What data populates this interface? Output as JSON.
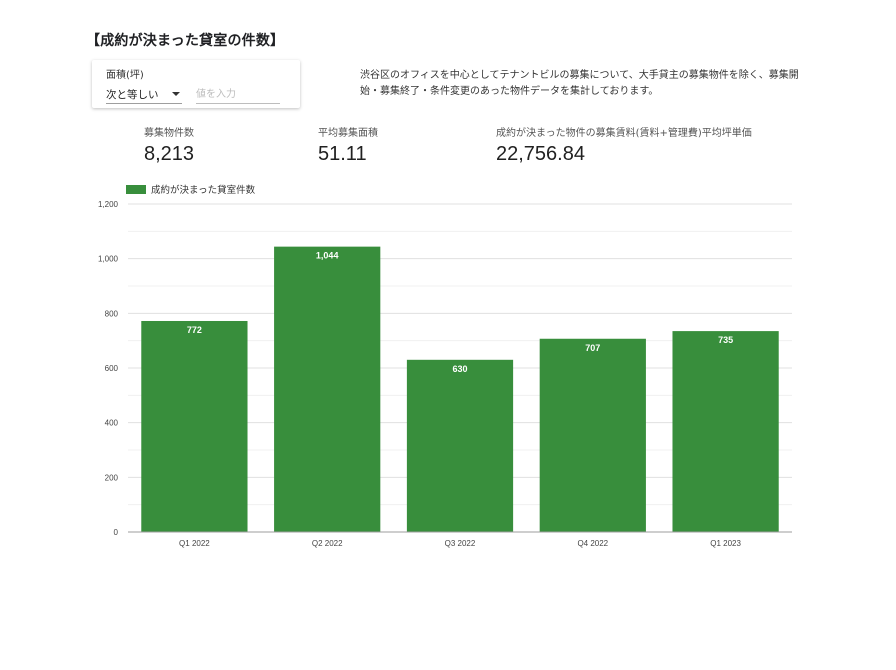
{
  "title": "【成約が決まった貸室の件数】",
  "filter": {
    "label": "面積(坪)",
    "operator": "次と等しい",
    "placeholder": "値を入力"
  },
  "description": "渋谷区のオフィスを中心としてテナントビルの募集について、大手貸主の募集物件を除く、募集開始・募集終了・条件変更のあった物件データを集計しております。",
  "kpis": [
    {
      "label": "募集物件数",
      "value": "8,213"
    },
    {
      "label": "平均募集面積",
      "value": "51.11"
    },
    {
      "label": "成約が決まった物件の募集賃料(賃料+管理費)平均坪単価",
      "value": "22,756.84"
    }
  ],
  "chart_data": {
    "type": "bar",
    "categories": [
      "Q1 2022",
      "Q2 2022",
      "Q3 2022",
      "Q4 2022",
      "Q1 2023"
    ],
    "series": [
      {
        "name": "成約が決まった貸室件数",
        "values": [
          772,
          1044,
          630,
          707,
          735
        ]
      }
    ],
    "data_labels": [
      "772",
      "1,044",
      "630",
      "707",
      "735"
    ],
    "yticks": [
      "0",
      "200",
      "400",
      "600",
      "800",
      "1,000",
      "1,200"
    ],
    "ylim": [
      0,
      1200
    ],
    "grid": true,
    "legend_position": "top-left",
    "color": "#388e3c"
  }
}
